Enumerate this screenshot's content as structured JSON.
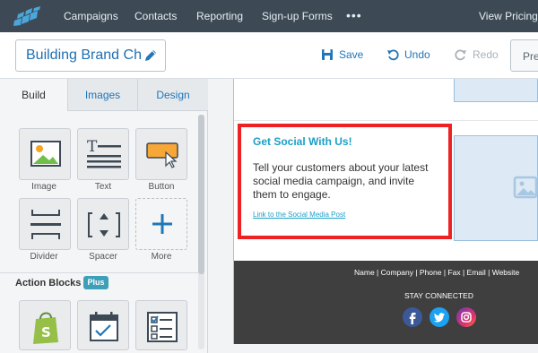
{
  "topnav": {
    "items": [
      "Campaigns",
      "Contacts",
      "Reporting",
      "Sign-up Forms"
    ],
    "more": "•••",
    "right": "View Pricing"
  },
  "toolbar": {
    "title": "Building Brand Cha",
    "save": "Save",
    "undo": "Undo",
    "redo": "Redo",
    "preview": "Pre"
  },
  "panel": {
    "tabs": [
      "Build",
      "Images",
      "Design"
    ],
    "blocks": [
      "Image",
      "Text",
      "Button",
      "Divider",
      "Spacer",
      "More"
    ],
    "action_blocks_title": "Action Blocks",
    "plus_badge": "Plus"
  },
  "email": {
    "heading": "Get Social With Us!",
    "body": "Tell your customers about your latest social media campaign, and invite them to engage.",
    "link": "Link to the Social Media Post",
    "footer_links": "Name | Company | Phone | Fax | Email | Website",
    "stay_connected": "STAY CONNECTED"
  },
  "colors": {
    "nav_bg": "#3d4a55",
    "accent_blue": "#2176b8",
    "highlight_red": "#ed2224",
    "heading_teal": "#1c9fc6",
    "footer_bg": "#3f3f3f",
    "plus_badge": "#3da0b8"
  }
}
